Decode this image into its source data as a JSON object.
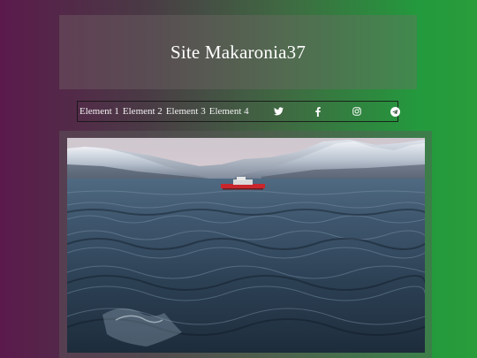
{
  "header": {
    "title": "Site Makaronia37"
  },
  "nav": {
    "items": [
      "Element 1",
      "Element 2",
      "Element 3",
      "Element 4"
    ]
  },
  "socials": {
    "icons": [
      "twitter-icon",
      "facebook-icon",
      "instagram-icon",
      "telegram-icon"
    ]
  },
  "colors": {
    "gradient_left": "#5b1a4c",
    "gradient_right": "#2a9c3c",
    "text": "#ffffff"
  }
}
